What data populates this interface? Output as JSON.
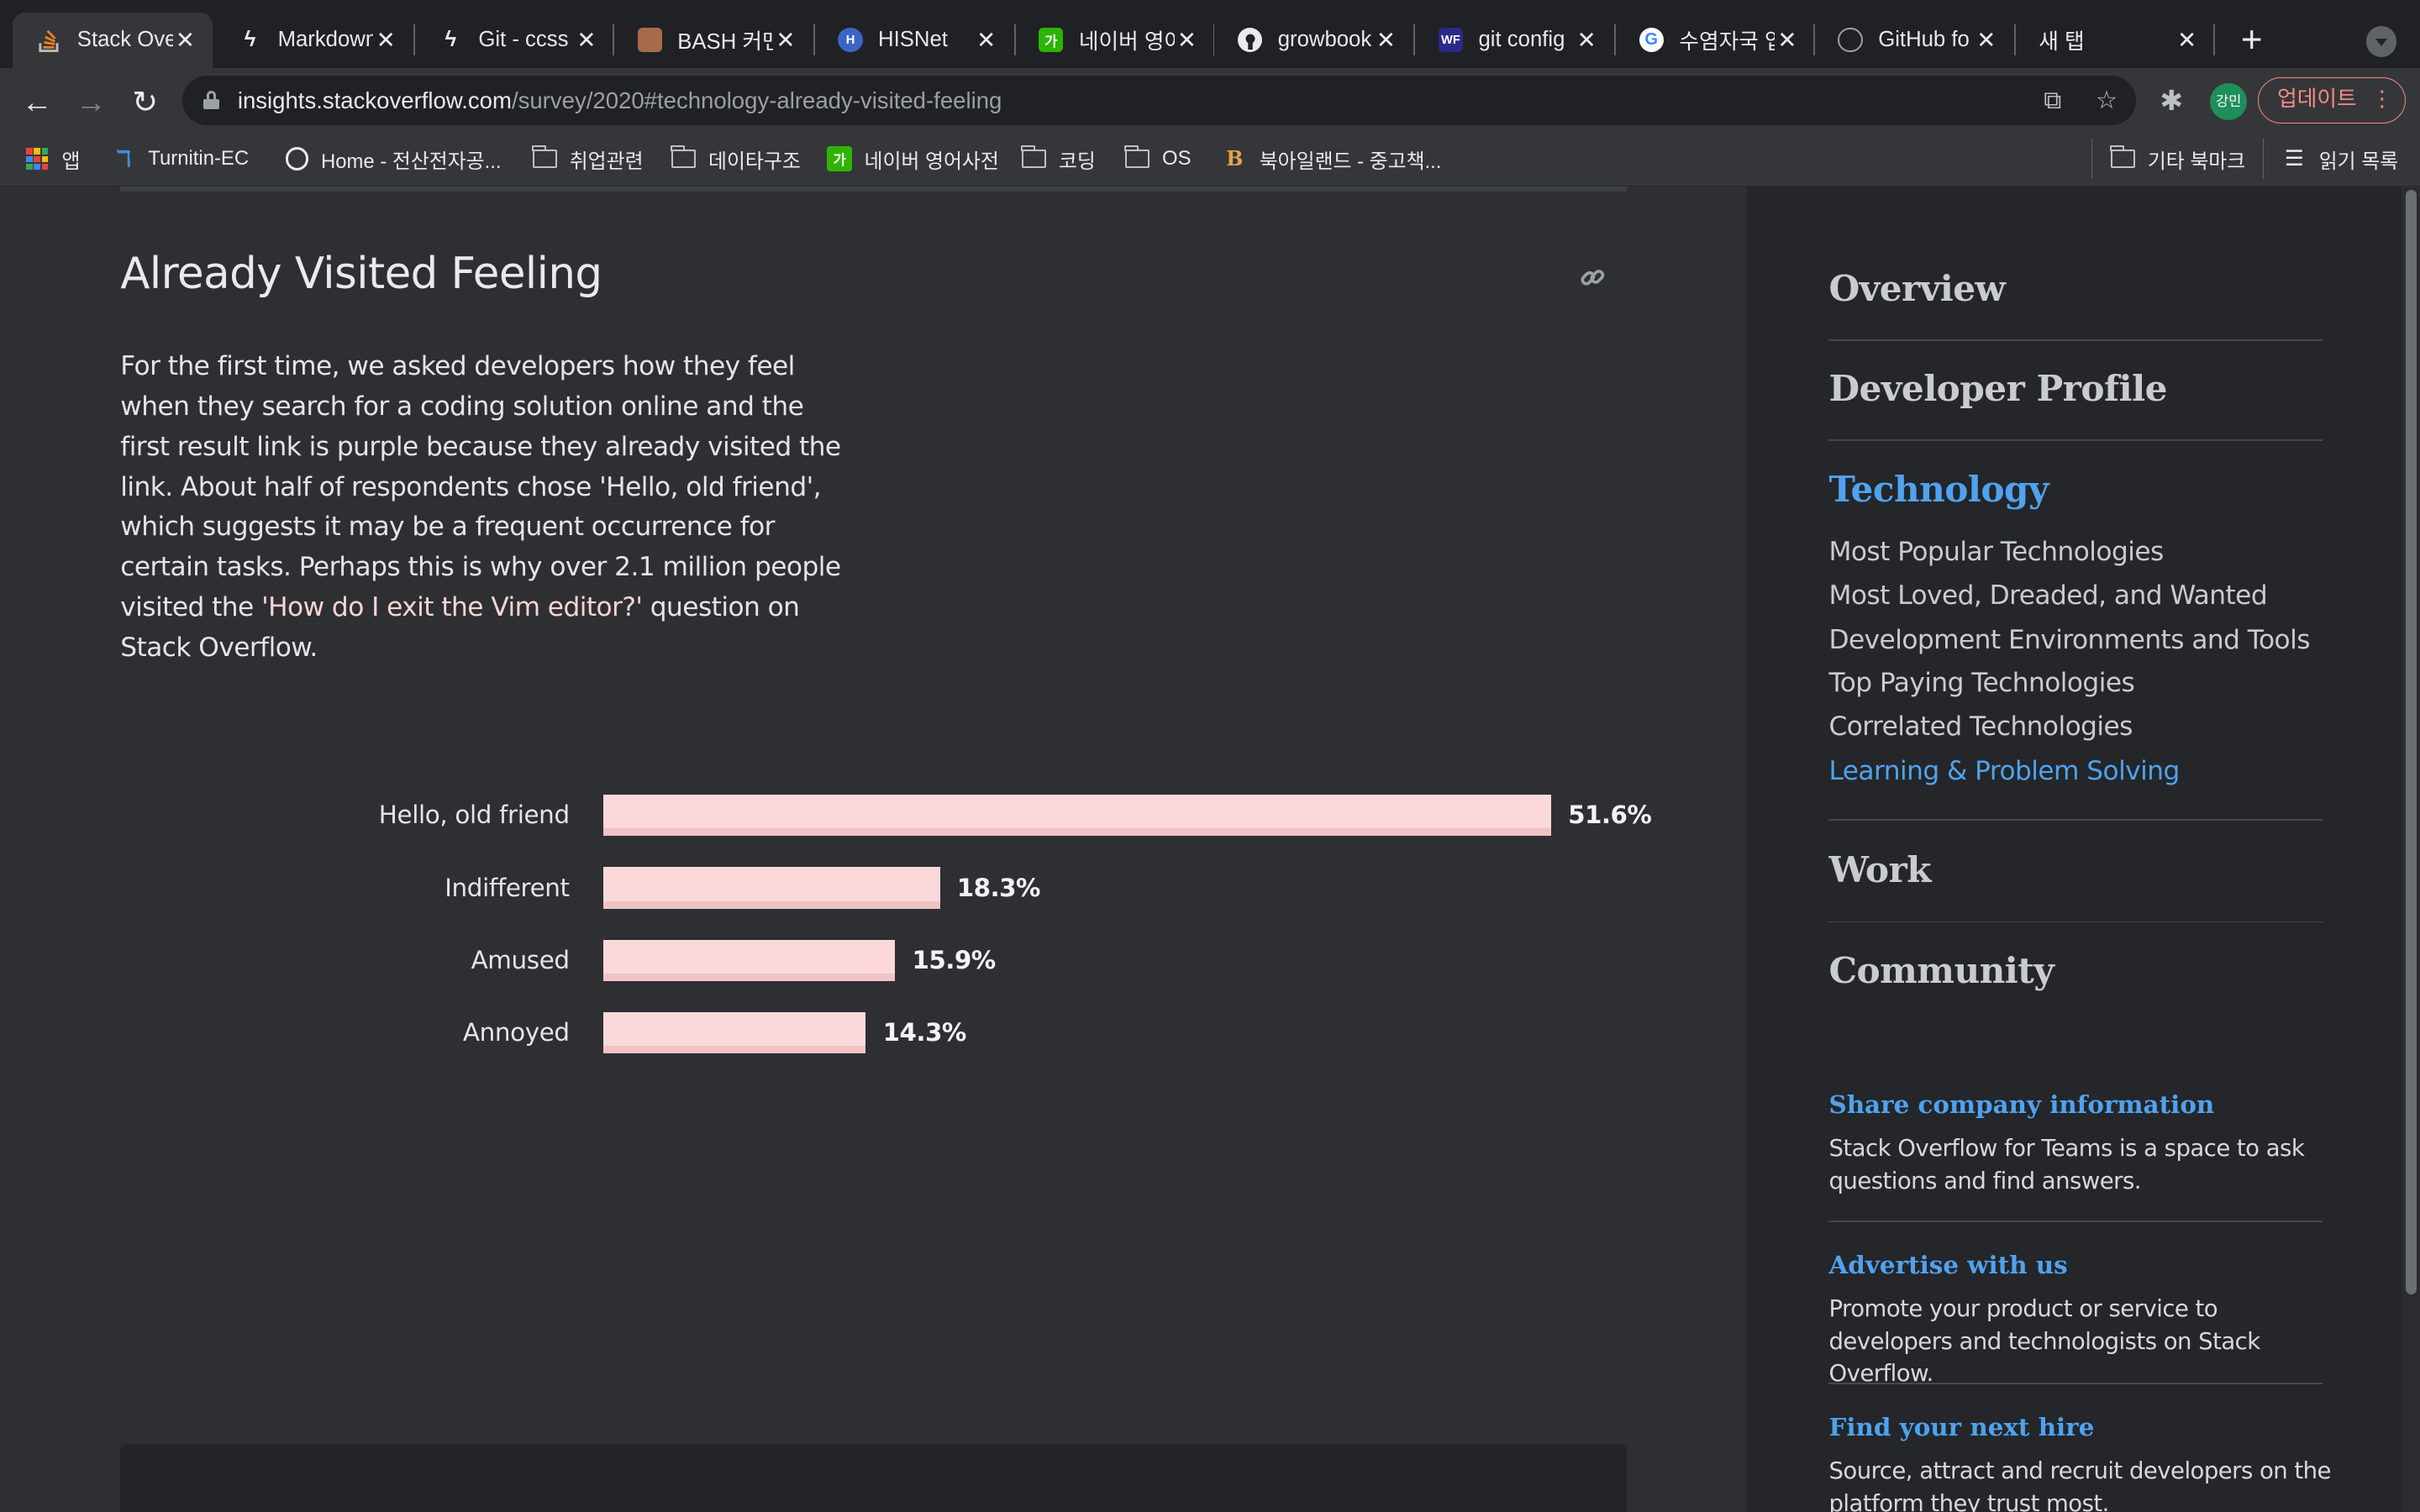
{
  "browser": {
    "tabs": [
      {
        "title": "Stack Overflow",
        "icon": "stackoverflow-icon",
        "color": "#f48024",
        "active": true
      },
      {
        "title": "Markdown",
        "icon": "bolt-icon",
        "color": "#e8eaed"
      },
      {
        "title": "Git - ccss",
        "icon": "bolt-icon",
        "color": "#e8eaed"
      },
      {
        "title": "BASH 커맨",
        "icon": "avatar-icon",
        "color": "#a86a4a"
      },
      {
        "title": "HISNet",
        "icon": "hisnet-icon",
        "color": "#3b64c8"
      },
      {
        "title": "네이버 영어",
        "icon": "naver-dict-icon",
        "color": "#2db400"
      },
      {
        "title": "growbook",
        "icon": "github-icon",
        "color": "#e8eaed"
      },
      {
        "title": "git config",
        "icon": "wf-icon",
        "color": "#2a2a8a"
      },
      {
        "title": "수염자국 업",
        "icon": "google-icon",
        "color": "#4285f4"
      },
      {
        "title": "GitHub fo",
        "icon": "globe-icon",
        "color": "#9aa0a6"
      },
      {
        "title": "새 탭",
        "icon": "",
        "color": ""
      }
    ],
    "url_host": "insights.stackoverflow.com",
    "url_path": "/survey/2020#technology-already-visited-feeling",
    "profile_label": "강민",
    "update_label": "업데이트",
    "bookmarks": [
      {
        "label": "앱",
        "icon": "apps-icon"
      },
      {
        "label": "Turnitin-EC",
        "icon": "turnitin-icon"
      },
      {
        "label": "Home - 전산전자공...",
        "icon": "globe-icon"
      },
      {
        "label": "취업관련",
        "icon": "folder-icon"
      },
      {
        "label": "데이타구조",
        "icon": "folder-icon"
      },
      {
        "label": "네이버 영어사전",
        "icon": "naver-dict-icon"
      },
      {
        "label": "코딩",
        "icon": "folder-icon"
      },
      {
        "label": "OS",
        "icon": "folder-icon"
      },
      {
        "label": "북아일랜드 - 중고책...",
        "icon": "bookshop-icon"
      },
      {
        "label": "기타 북마크",
        "icon": "folder-icon"
      },
      {
        "label": "읽기 목록",
        "icon": "reading-list-icon"
      }
    ]
  },
  "article": {
    "title": "Already Visited Feeling",
    "intro_before": "For the first time, we asked developers how they feel when they search for a coding solution online and the first result link is purple because they already visited the link. About half of respondents chose 'Hello, old friend', which suggests it may be a frequent occurrence for certain tasks. Perhaps this is why over 2.1 million people visited the ",
    "intro_link": "'How do I exit the Vim editor?'",
    "intro_after": " question on Stack Overflow."
  },
  "chart_data": {
    "type": "bar",
    "orientation": "horizontal",
    "categories": [
      "Hello, old friend",
      "Indifferent",
      "Amused",
      "Annoyed"
    ],
    "values": [
      51.6,
      18.3,
      15.9,
      14.3
    ],
    "value_labels": [
      "51.6%",
      "18.3%",
      "15.9%",
      "14.3%"
    ],
    "bar_color": "#fbd9da",
    "title": "",
    "xlabel": "",
    "ylabel": "",
    "grid": false
  },
  "sidebar": {
    "sections": [
      {
        "label": "Overview",
        "active": false
      },
      {
        "label": "Developer Profile",
        "active": false
      },
      {
        "label": "Technology",
        "active": true
      },
      {
        "label": "Work",
        "active": false
      },
      {
        "label": "Community",
        "active": false
      }
    ],
    "technology_items": [
      {
        "label": "Most Popular Technologies",
        "active": false
      },
      {
        "label": "Most Loved, Dreaded, and Wanted",
        "active": false
      },
      {
        "label": "Development Environments and Tools",
        "active": false
      },
      {
        "label": "Top Paying Technologies",
        "active": false
      },
      {
        "label": "Correlated Technologies",
        "active": false
      },
      {
        "label": "Learning & Problem Solving",
        "active": true
      }
    ],
    "promos": [
      {
        "heading": "Share company information",
        "text": "Stack Overflow for Teams is a space to ask questions and find answers."
      },
      {
        "heading": "Advertise with us",
        "text": "Promote your product or service to developers and technologists on Stack Overflow."
      },
      {
        "heading": "Find your next hire",
        "text": "Source, attract and recruit developers on the platform they trust most."
      }
    ]
  },
  "colors": {
    "accent": "#4fa2ef",
    "background": "#2d2f33",
    "sidebar_bg": "#242629",
    "bar": "#fbd9da",
    "update_button": "#f28b82"
  }
}
